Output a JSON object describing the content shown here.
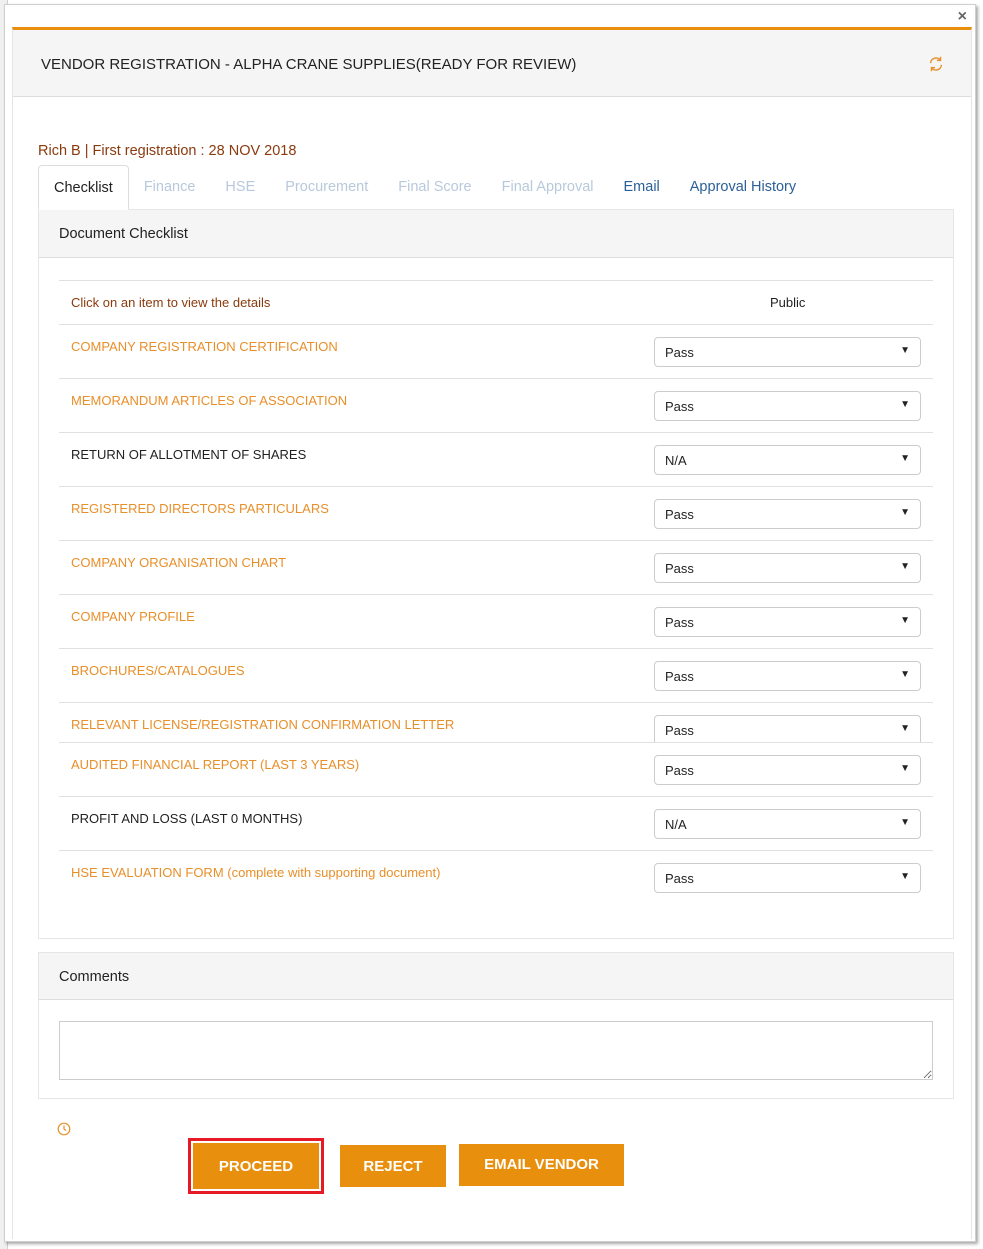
{
  "window": {
    "close_glyph": "×",
    "title": "VENDOR REGISTRATION - ALPHA CRANE SUPPLIES(READY FOR REVIEW)",
    "refresh_icon": "refresh-icon"
  },
  "subheader": "Rich B | First registration : 28 NOV 2018",
  "tabs": [
    {
      "label": "Checklist",
      "state": "active"
    },
    {
      "label": "Finance",
      "state": "disabled"
    },
    {
      "label": "HSE",
      "state": "disabled"
    },
    {
      "label": "Procurement",
      "state": "disabled"
    },
    {
      "label": "Final Score",
      "state": "disabled"
    },
    {
      "label": "Final Approval",
      "state": "disabled"
    },
    {
      "label": "Email",
      "state": "link"
    },
    {
      "label": "Approval History",
      "state": "link"
    }
  ],
  "checklist": {
    "heading": "Document Checklist",
    "instruction": "Click on an item to view the details",
    "column_public": "Public",
    "items": [
      {
        "name": "COMPANY REGISTRATION CERTIFICATION",
        "color": "orange",
        "value": "Pass"
      },
      {
        "name": "MEMORANDUM ARTICLES OF ASSOCIATION",
        "color": "orange",
        "value": "Pass"
      },
      {
        "name": "RETURN OF ALLOTMENT OF SHARES",
        "color": "black",
        "value": "N/A"
      },
      {
        "name": "REGISTERED DIRECTORS PARTICULARS",
        "color": "orange",
        "value": "Pass"
      },
      {
        "name": "COMPANY ORGANISATION CHART",
        "color": "orange",
        "value": "Pass"
      },
      {
        "name": "COMPANY PROFILE",
        "color": "orange",
        "value": "Pass"
      },
      {
        "name": "BROCHURES/CATALOGUES",
        "color": "orange",
        "value": "Pass"
      },
      {
        "name": "RELEVANT LICENSE/REGISTRATION CONFIRMATION LETTER",
        "color": "orange",
        "value": "Pass"
      },
      {
        "name": "AUDITED FINANCIAL REPORT (LAST 3 YEARS)",
        "color": "orange",
        "value": "Pass"
      },
      {
        "name": "PROFIT AND LOSS (LAST 0 MONTHS)",
        "color": "black",
        "value": "N/A"
      },
      {
        "name": "HSE EVALUATION FORM (complete with supporting document)",
        "color": "orange",
        "value": "Pass"
      }
    ]
  },
  "comments": {
    "heading": "Comments",
    "value": ""
  },
  "actions": {
    "proceed": "PROCEED",
    "reject": "REJECT",
    "email_vendor": "EMAIL VENDOR"
  },
  "colors": {
    "accent": "#e88f0d",
    "link_orange": "#e88f2a",
    "subheader_brown": "#8b3a0e",
    "tab_link_blue": "#2b5f97",
    "tab_disabled": "#b8c9dc",
    "highlight_red": "#e51a24"
  }
}
